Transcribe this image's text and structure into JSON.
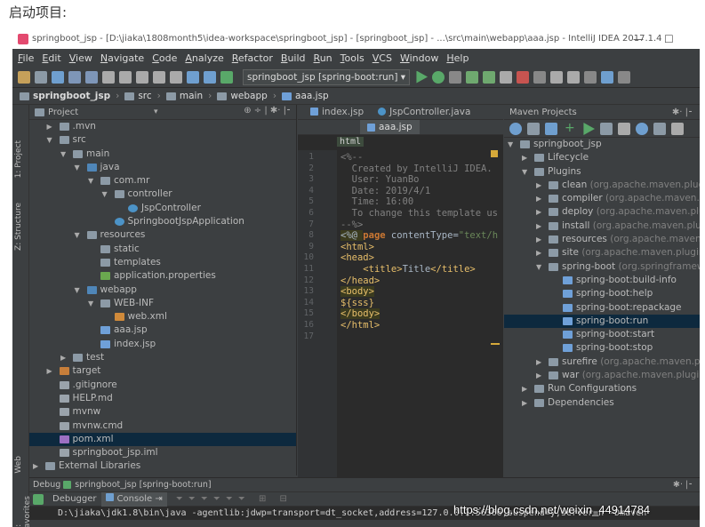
{
  "caption": "启动项目:",
  "window": {
    "title": "springboot_jsp - [D:\\jiaka\\1808month5\\idea-workspace\\springboot_jsp] - [springboot_jsp] - ...\\src\\main\\webapp\\aaa.jsp - IntelliJ IDEA 2017.1.4",
    "controls": [
      "—",
      "☐",
      "✕"
    ]
  },
  "menu": [
    "File",
    "Edit",
    "View",
    "Navigate",
    "Code",
    "Analyze",
    "Refactor",
    "Build",
    "Run",
    "Tools",
    "VCS",
    "Window",
    "Help"
  ],
  "toolbar": {
    "run_config": "springboot_jsp [spring-boot:run]"
  },
  "breadcrumb": [
    "springboot_jsp",
    "src",
    "main",
    "webapp",
    "aaa.jsp"
  ],
  "side_tabs": {
    "project": "1: Project",
    "structure": "Z: Structure",
    "web": "Web",
    "favorites": "2: Favorites"
  },
  "project_panel": {
    "title": "Project",
    "rows": [
      {
        "label": ".mvn",
        "depth": 1,
        "arrow": "▶",
        "icon": "folder",
        "selected": false
      },
      {
        "label": "src",
        "depth": 1,
        "arrow": "▼",
        "icon": "folder",
        "selected": false
      },
      {
        "label": "main",
        "depth": 2,
        "arrow": "▼",
        "icon": "folder",
        "selected": false
      },
      {
        "label": "java",
        "depth": 3,
        "arrow": "▼",
        "icon": "folder-blue",
        "selected": false
      },
      {
        "label": "com.mr",
        "depth": 4,
        "arrow": "▼",
        "icon": "package",
        "selected": false
      },
      {
        "label": "controller",
        "depth": 5,
        "arrow": "▼",
        "icon": "package",
        "selected": false
      },
      {
        "label": "JspController",
        "depth": 6,
        "arrow": "",
        "icon": "class",
        "selected": false
      },
      {
        "label": "SpringbootJspApplication",
        "depth": 5,
        "arrow": "",
        "icon": "spring-class",
        "selected": false
      },
      {
        "label": "resources",
        "depth": 3,
        "arrow": "▼",
        "icon": "resources",
        "selected": false
      },
      {
        "label": "static",
        "depth": 4,
        "arrow": "",
        "icon": "folder",
        "selected": false
      },
      {
        "label": "templates",
        "depth": 4,
        "arrow": "",
        "icon": "folder",
        "selected": false
      },
      {
        "label": "application.properties",
        "depth": 4,
        "arrow": "",
        "icon": "properties",
        "selected": false
      },
      {
        "label": "webapp",
        "depth": 3,
        "arrow": "▼",
        "icon": "folder-blue",
        "selected": false
      },
      {
        "label": "WEB-INF",
        "depth": 4,
        "arrow": "▼",
        "icon": "folder",
        "selected": false
      },
      {
        "label": "web.xml",
        "depth": 5,
        "arrow": "",
        "icon": "xml",
        "selected": false
      },
      {
        "label": "aaa.jsp",
        "depth": 4,
        "arrow": "",
        "icon": "jsp",
        "selected": false
      },
      {
        "label": "index.jsp",
        "depth": 4,
        "arrow": "",
        "icon": "jsp",
        "selected": false
      },
      {
        "label": "test",
        "depth": 2,
        "arrow": "▶",
        "icon": "folder",
        "selected": false
      },
      {
        "label": "target",
        "depth": 1,
        "arrow": "▶",
        "icon": "folder-orange",
        "selected": false
      },
      {
        "label": ".gitignore",
        "depth": 1,
        "arrow": "",
        "icon": "file",
        "selected": false
      },
      {
        "label": "HELP.md",
        "depth": 1,
        "arrow": "",
        "icon": "file",
        "selected": false
      },
      {
        "label": "mvnw",
        "depth": 1,
        "arrow": "",
        "icon": "file",
        "selected": false
      },
      {
        "label": "mvnw.cmd",
        "depth": 1,
        "arrow": "",
        "icon": "file",
        "selected": false
      },
      {
        "label": "pom.xml",
        "depth": 1,
        "arrow": "",
        "icon": "maven",
        "selected": true
      },
      {
        "label": "springboot_jsp.iml",
        "depth": 1,
        "arrow": "",
        "icon": "file",
        "selected": false
      },
      {
        "label": "External Libraries",
        "depth": 0,
        "arrow": "▶",
        "icon": "libraries",
        "selected": false
      }
    ]
  },
  "editor": {
    "tabs": [
      {
        "label": "index.jsp",
        "active": false
      },
      {
        "label": "JspController.java",
        "active": false
      }
    ],
    "active_tab": "aaa.jsp",
    "tag_crumb": "html",
    "lines": [
      {
        "n": "1",
        "parts": [
          {
            "t": "<%--",
            "c": "c-cmt"
          }
        ]
      },
      {
        "n": "2",
        "parts": [
          {
            "t": "  Created by IntelliJ IDEA.",
            "c": "c-cmt"
          }
        ]
      },
      {
        "n": "3",
        "parts": [
          {
            "t": "  User: YuanBo",
            "c": "c-cmt"
          }
        ]
      },
      {
        "n": "4",
        "parts": [
          {
            "t": "  Date: 2019/4/1",
            "c": "c-cmt"
          }
        ]
      },
      {
        "n": "5",
        "parts": [
          {
            "t": "  Time: 16:00",
            "c": "c-cmt"
          }
        ]
      },
      {
        "n": "6",
        "parts": [
          {
            "t": "  To change this template us",
            "c": "c-cmt"
          }
        ]
      },
      {
        "n": "7",
        "parts": [
          {
            "t": "--%>",
            "c": "c-cmt"
          }
        ]
      },
      {
        "n": "8",
        "parts": [
          {
            "t": "<%@ ",
            "c": "c-hl"
          },
          {
            "t": "page ",
            "c": "c-kw"
          },
          {
            "t": "contentType=",
            "c": ""
          },
          {
            "t": "\"text/h",
            "c": "c-str"
          }
        ]
      },
      {
        "n": "9",
        "parts": [
          {
            "t": "<html>",
            "c": "c-tag"
          }
        ]
      },
      {
        "n": "10",
        "parts": [
          {
            "t": "<head>",
            "c": "c-tag"
          }
        ]
      },
      {
        "n": "11",
        "parts": [
          {
            "t": "    ",
            "c": ""
          },
          {
            "t": "<title>",
            "c": "c-tag"
          },
          {
            "t": "Title",
            "c": ""
          },
          {
            "t": "</title>",
            "c": "c-tag"
          }
        ]
      },
      {
        "n": "12",
        "parts": [
          {
            "t": "</head>",
            "c": "c-tag"
          }
        ]
      },
      {
        "n": "13",
        "parts": [
          {
            "t": "<body>",
            "c": "c-tag c-hl"
          }
        ]
      },
      {
        "n": "14",
        "parts": [
          {
            "t": "${sss}",
            "c": "c-tag"
          }
        ]
      },
      {
        "n": "15",
        "parts": [
          {
            "t": "</body>",
            "c": "c-tag c-hl"
          }
        ]
      },
      {
        "n": "16",
        "parts": [
          {
            "t": "</html>",
            "c": "c-tag"
          }
        ]
      },
      {
        "n": "17",
        "parts": [
          {
            "t": "",
            "c": ""
          }
        ]
      }
    ]
  },
  "maven_panel": {
    "title": "Maven Projects",
    "rows": [
      {
        "label": "springboot_jsp",
        "detail": "",
        "depth": 0,
        "arrow": "▼",
        "selected": false
      },
      {
        "label": "Lifecycle",
        "detail": "",
        "depth": 1,
        "arrow": "▶",
        "selected": false
      },
      {
        "label": "Plugins",
        "detail": "",
        "depth": 1,
        "arrow": "▼",
        "selected": false
      },
      {
        "label": "clean",
        "detail": "(org.apache.maven.plugins:m",
        "depth": 2,
        "arrow": "▶",
        "selected": false
      },
      {
        "label": "compiler",
        "detail": "(org.apache.maven.plugin",
        "depth": 2,
        "arrow": "▶",
        "selected": false
      },
      {
        "label": "deploy",
        "detail": "(org.apache.maven.plugins:",
        "depth": 2,
        "arrow": "▶",
        "selected": false
      },
      {
        "label": "install",
        "detail": "(org.apache.maven.plugins:m",
        "depth": 2,
        "arrow": "▶",
        "selected": false
      },
      {
        "label": "resources",
        "detail": "(org.apache.maven.plugi",
        "depth": 2,
        "arrow": "▶",
        "selected": false
      },
      {
        "label": "site",
        "detail": "(org.apache.maven.plugins:mav",
        "depth": 2,
        "arrow": "▶",
        "selected": false
      },
      {
        "label": "spring-boot",
        "detail": "(org.springframework.b",
        "depth": 2,
        "arrow": "▼",
        "selected": false
      },
      {
        "label": "spring-boot:build-info",
        "detail": "",
        "depth": 3,
        "arrow": "",
        "selected": false
      },
      {
        "label": "spring-boot:help",
        "detail": "",
        "depth": 3,
        "arrow": "",
        "selected": false
      },
      {
        "label": "spring-boot:repackage",
        "detail": "",
        "depth": 3,
        "arrow": "",
        "selected": false
      },
      {
        "label": "spring-boot:run",
        "detail": "",
        "depth": 3,
        "arrow": "",
        "selected": true
      },
      {
        "label": "spring-boot:start",
        "detail": "",
        "depth": 3,
        "arrow": "",
        "selected": false
      },
      {
        "label": "spring-boot:stop",
        "detail": "",
        "depth": 3,
        "arrow": "",
        "selected": false
      },
      {
        "label": "surefire",
        "detail": "(org.apache.maven.plugins.",
        "depth": 2,
        "arrow": "▶",
        "selected": false
      },
      {
        "label": "war",
        "detail": "(org.apache.maven.plugins:mav",
        "depth": 2,
        "arrow": "▶",
        "selected": false
      },
      {
        "label": "Run Configurations",
        "detail": "",
        "depth": 1,
        "arrow": "▶",
        "selected": false
      },
      {
        "label": "Dependencies",
        "detail": "",
        "depth": 1,
        "arrow": "▶",
        "selected": false
      }
    ]
  },
  "debug": {
    "title": "Debug",
    "config": "springboot_jsp [spring-boot:run]",
    "tabs": [
      "Debugger",
      "Console"
    ],
    "console_line": "D:\\jiaka\\jdk1.8\\bin\\java -agentlib:jdwp=transport=dt_socket,address=127.0.0.1:56366,suspend=y,server=n -Dmaven"
  },
  "watermark": "https://blog.csdn.net/weixin_44914784",
  "colors": {
    "selection": "#0d293e",
    "maven_selection": "#0d293e",
    "run_green": "#59a869",
    "stop_red": "#c75450"
  }
}
